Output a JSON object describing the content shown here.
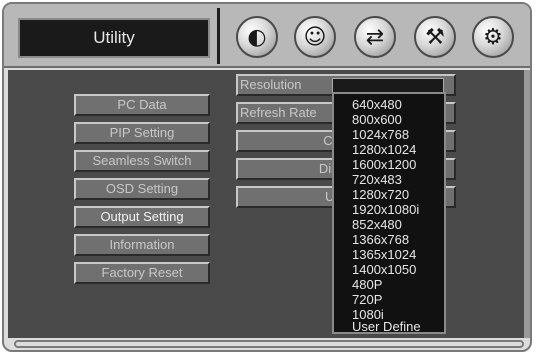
{
  "header": {
    "title": "Utility",
    "icons": [
      "image-adjust-icon",
      "smiley-monitor-icon",
      "input-source-icon",
      "tools-icon",
      "utility-gears-icon"
    ],
    "glyphs": [
      "◐",
      "☺",
      "⇄",
      "⚒",
      "⚙"
    ]
  },
  "menu": {
    "items": [
      "PC Data",
      "PIP Setting",
      "Seamless Switch",
      "OSD Setting",
      "Output Setting",
      "Information",
      "Factory Reset"
    ],
    "active": "Output Setting"
  },
  "submenu": {
    "resolution_label": "Resolution",
    "refresh_rate_label": "Refresh Rate",
    "confirm_label": "Confirm",
    "discard_label": "Discard y",
    "user_mode_label": "User M"
  },
  "dropdown": {
    "options": [
      "640x480",
      "800x600",
      "1024x768",
      "1280x1024",
      "1600x1200",
      "720x483",
      "1280x720",
      "1920x1080i",
      "852x480",
      "1366x768",
      "1365x1024",
      "1400x1050",
      "480P",
      "720P",
      "1080i",
      "User Define"
    ]
  },
  "colors": {
    "panel": "#4a4a4a",
    "button": "#707070",
    "title_bg": "#1a1a1a",
    "dropdown_bg": "#111111"
  }
}
